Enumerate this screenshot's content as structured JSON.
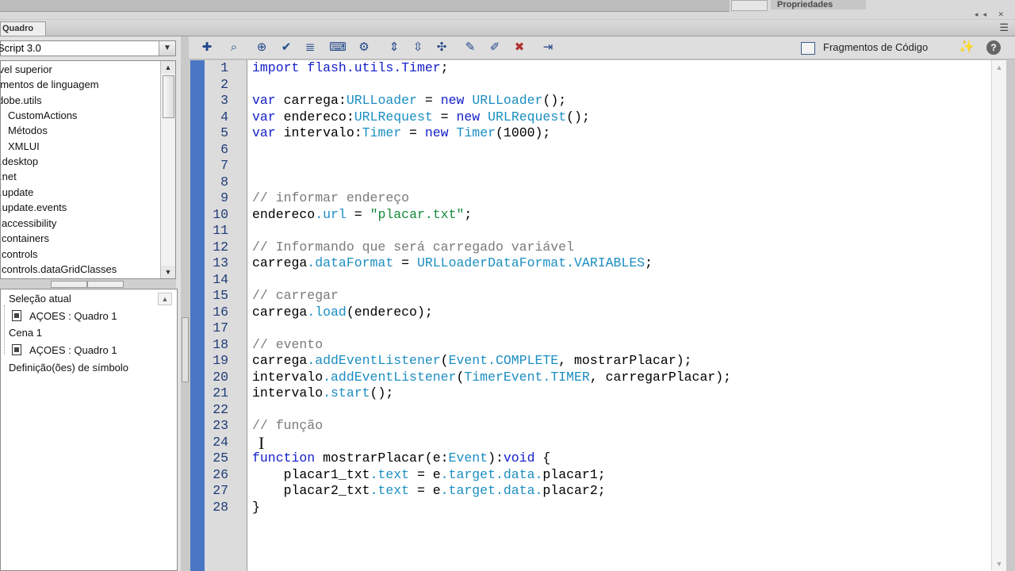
{
  "top": {
    "properties_tab": "Propriedades"
  },
  "panel": {
    "tab_label": "Quadro"
  },
  "left": {
    "version_select": "Script 3.0",
    "library_items": [
      "ível superior",
      "ementos de linguagem",
      "dobe.utils",
      "CustomActions",
      "Métodos",
      "XMLUI",
      ".desktop",
      ".net",
      ".update",
      ".update.events",
      "accessibility",
      "containers",
      "controls",
      "controls.dataGridClasses"
    ],
    "scene_items": [
      "Seleção atual",
      "AÇOES : Quadro 1",
      "Cena 1",
      "AÇOES : Quadro 1",
      "Definição(ões) de símbolo"
    ]
  },
  "toolbar": {
    "snippets_label": "Fragmentos de Código",
    "help_label": "?"
  },
  "editor": {
    "line_numbers": [
      "1",
      "2",
      "3",
      "4",
      "5",
      "6",
      "7",
      "8",
      "9",
      "10",
      "11",
      "12",
      "13",
      "14",
      "15",
      "16",
      "17",
      "18",
      "19",
      "20",
      "21",
      "22",
      "23",
      "24",
      "25",
      "26",
      "27",
      "28"
    ],
    "lines": [
      "import flash.utils.Timer;",
      "",
      "var carrega:URLLoader = new URLLoader();",
      "var endereco:URLRequest = new URLRequest();",
      "var intervalo:Timer = new Timer(1000);",
      "",
      "",
      "",
      "// informar endereço",
      "endereco.url = \"placar.txt\";",
      "",
      "// Informando que será carregado variável",
      "carrega.dataFormat = URLLoaderDataFormat.VARIABLES;",
      "",
      "// carregar",
      "carrega.load(endereco);",
      "",
      "// evento",
      "carrega.addEventListener(Event.COMPLETE, mostrarPlacar);",
      "intervalo.addEventListener(TimerEvent.TIMER, carregarPlacar);",
      "intervalo.start();",
      "",
      "// função",
      "",
      "function mostrarPlacar(e:Event):void {",
      "    placar1_txt.text = e.target.data.placar1;",
      "    placar2_txt.text = e.target.data.placar2;",
      "}"
    ]
  }
}
